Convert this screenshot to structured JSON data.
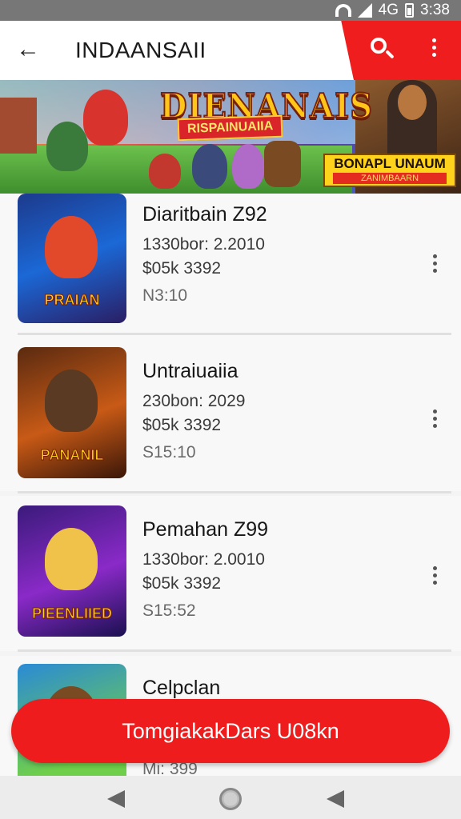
{
  "status_bar": {
    "network": "4G",
    "time": "3:38"
  },
  "app_bar": {
    "title": "INDAANSAII",
    "back_icon": "arrow-left-icon",
    "search_icon": "search-icon",
    "more_icon": "more-vert-icon",
    "accent_color": "#ef1d1d"
  },
  "banner": {
    "title": "DIENANAIS",
    "subtitle": "RISPAINUAIIA",
    "badge_title": "BONAPL UNAUM",
    "badge_subtitle": "ZANIMBAARN"
  },
  "list": {
    "items": [
      {
        "title": "Diaritbain Z92",
        "line1": "1330bor: 2.2010",
        "line2": "$05k 3392",
        "line3": "N3:10",
        "thumb_label": "PRAIAN"
      },
      {
        "title": "Untraiuaiia",
        "line1": "230bon: 2029",
        "line2": "$05k 3392",
        "line3": "S15:10",
        "thumb_label": "PANANIL"
      },
      {
        "title": "Pemahan Z99",
        "line1": "1330bor: 2.0010",
        "line2": "$05k 3392",
        "line3": "S15:52",
        "thumb_label": "PIEENLIIED"
      },
      {
        "title": "Celpclan",
        "line1": "",
        "line2": "",
        "line3": "Mi: 399",
        "thumb_label": ""
      }
    ]
  },
  "cta": {
    "label": "TomgiakakDars U08kn"
  }
}
